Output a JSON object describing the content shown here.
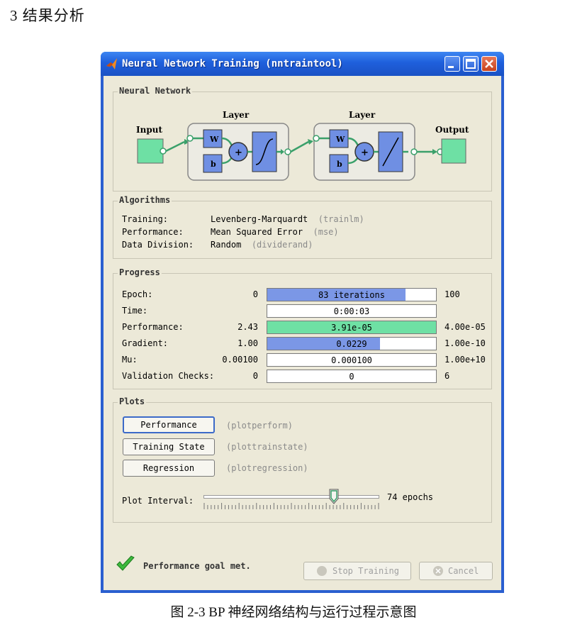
{
  "document": {
    "heading": "3 结果分析",
    "caption": "图 2-3 BP 神经网络结构与运行过程示意图"
  },
  "window": {
    "title": "Neural Network Training (nntraintool)"
  },
  "network": {
    "group_title": "Neural Network",
    "input_label": "Input",
    "layer1_label": "Layer",
    "layer2_label": "Layer",
    "output_label": "Output",
    "weight_label": "W",
    "bias_label": "b",
    "sum_label": "+"
  },
  "algorithms": {
    "group_title": "Algorithms",
    "rows": [
      {
        "label": "Training:",
        "value": "Levenberg-Marquardt",
        "fn": "(trainlm)"
      },
      {
        "label": "Performance:",
        "value": "Mean Squared Error",
        "fn": "(mse)"
      },
      {
        "label": "Data Division:",
        "value": "Random",
        "fn": "(dividerand)"
      }
    ]
  },
  "progress": {
    "group_title": "Progress",
    "rows": [
      {
        "label": "Epoch:",
        "start": "0",
        "bar": "83 iterations",
        "end": "100",
        "fill": 0.82,
        "color": "#7b97e6"
      },
      {
        "label": "Time:",
        "start": "",
        "bar": "0:00:03",
        "end": "",
        "fill": 0,
        "color": "#ffffff"
      },
      {
        "label": "Performance:",
        "start": "2.43",
        "bar": "3.91e-05",
        "end": "4.00e-05",
        "fill": 1.0,
        "color": "#6ee0a4"
      },
      {
        "label": "Gradient:",
        "start": "1.00",
        "bar": "0.0229",
        "end": "1.00e-10",
        "fill": 0.67,
        "color": "#7b97e6"
      },
      {
        "label": "Mu:",
        "start": "0.00100",
        "bar": "0.000100",
        "end": "1.00e+10",
        "fill": 0,
        "color": "#ffffff"
      },
      {
        "label": "Validation Checks:",
        "start": "0",
        "bar": "0",
        "end": "6",
        "fill": 0,
        "color": "#ffffff"
      }
    ]
  },
  "plots": {
    "group_title": "Plots",
    "buttons": [
      {
        "label": "Performance",
        "fn": "(plotperform)"
      },
      {
        "label": "Training State",
        "fn": "(plottrainstate)"
      },
      {
        "label": "Regression",
        "fn": "(plotregression)"
      }
    ],
    "interval_label": "Plot Interval:",
    "interval_value": "74 epochs",
    "slider_level": 0.74
  },
  "status": {
    "message": "Performance goal met."
  },
  "footer": {
    "stop_label": "Stop Training",
    "cancel_label": "Cancel"
  },
  "colors": {
    "titlebar": "#1f5fdc",
    "client_bg": "#ece9d8",
    "io_green": "#6ee0a4",
    "block_blue": "#6f8fe3",
    "connector_green": "#3aa06a"
  }
}
